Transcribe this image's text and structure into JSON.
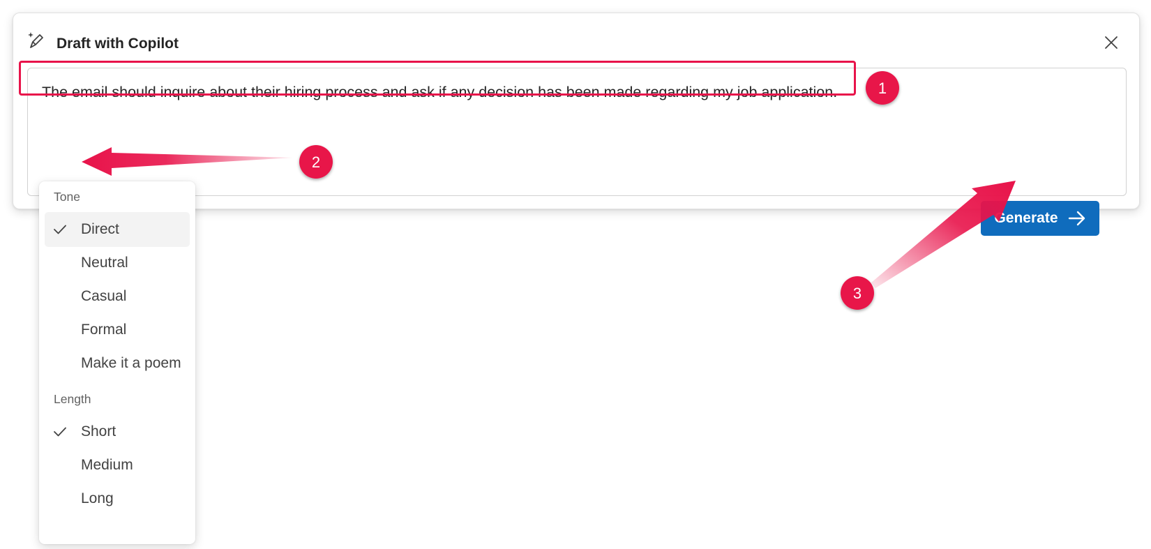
{
  "dialog": {
    "title": "Draft with Copilot",
    "title_icon": "copilot-draft-pen-sparkle-icon",
    "close_icon": "close-icon"
  },
  "prompt": {
    "value": "The email should inquire about their hiring process and ask if any decision has been made regarding my job application."
  },
  "toolbar": {
    "settings_icon": "sliders-settings-icon",
    "generate_label": "Generate",
    "generate_icon": "arrow-right-icon"
  },
  "menu": {
    "tone_header": "Tone",
    "tone_options": [
      {
        "label": "Direct",
        "checked": true
      },
      {
        "label": "Neutral",
        "checked": false
      },
      {
        "label": "Casual",
        "checked": false
      },
      {
        "label": "Formal",
        "checked": false
      },
      {
        "label": "Make it a poem",
        "checked": false
      }
    ],
    "length_header": "Length",
    "length_options": [
      {
        "label": "Short",
        "checked": true
      },
      {
        "label": "Medium",
        "checked": false
      },
      {
        "label": "Long",
        "checked": false
      }
    ]
  },
  "annotations": {
    "markers": [
      "1",
      "2",
      "3"
    ],
    "color": "#e8134a"
  },
  "colors": {
    "accent": "#0f6cbd",
    "annotation": "#e8134a"
  }
}
